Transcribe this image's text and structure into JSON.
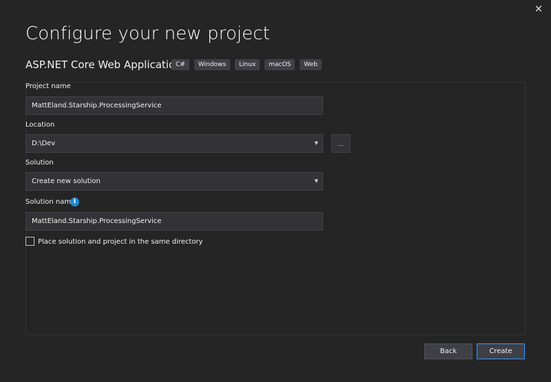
{
  "window": {
    "title": "Configure your new project",
    "close_glyph": "✕"
  },
  "template": {
    "name": "ASP.NET Core Web Application",
    "tags": [
      "C#",
      "Windows",
      "Linux",
      "macOS",
      "Web"
    ]
  },
  "form": {
    "project_name": {
      "label": "Project name",
      "value": "MattEland.Starship.ProcessingService"
    },
    "location": {
      "label": "Location",
      "value": "D:\\Dev",
      "browse_glyph": "..."
    },
    "solution": {
      "label": "Solution",
      "value": "Create new solution"
    },
    "solution_name": {
      "label": "Solution name",
      "value": "MattEland.Starship.ProcessingService",
      "info_glyph": "i"
    },
    "same_directory": {
      "label": "Place solution and project in the same directory",
      "checked": false
    }
  },
  "buttons": {
    "back": "Back",
    "create": "Create"
  },
  "icons": {
    "close": "close-icon",
    "dropdown": "chevron-down-icon",
    "info": "info-icon",
    "browse": "browse-icon"
  },
  "colors": {
    "background": "#252526",
    "field": "#333337",
    "accent": "#3399ff",
    "info": "#1e8ad6"
  }
}
